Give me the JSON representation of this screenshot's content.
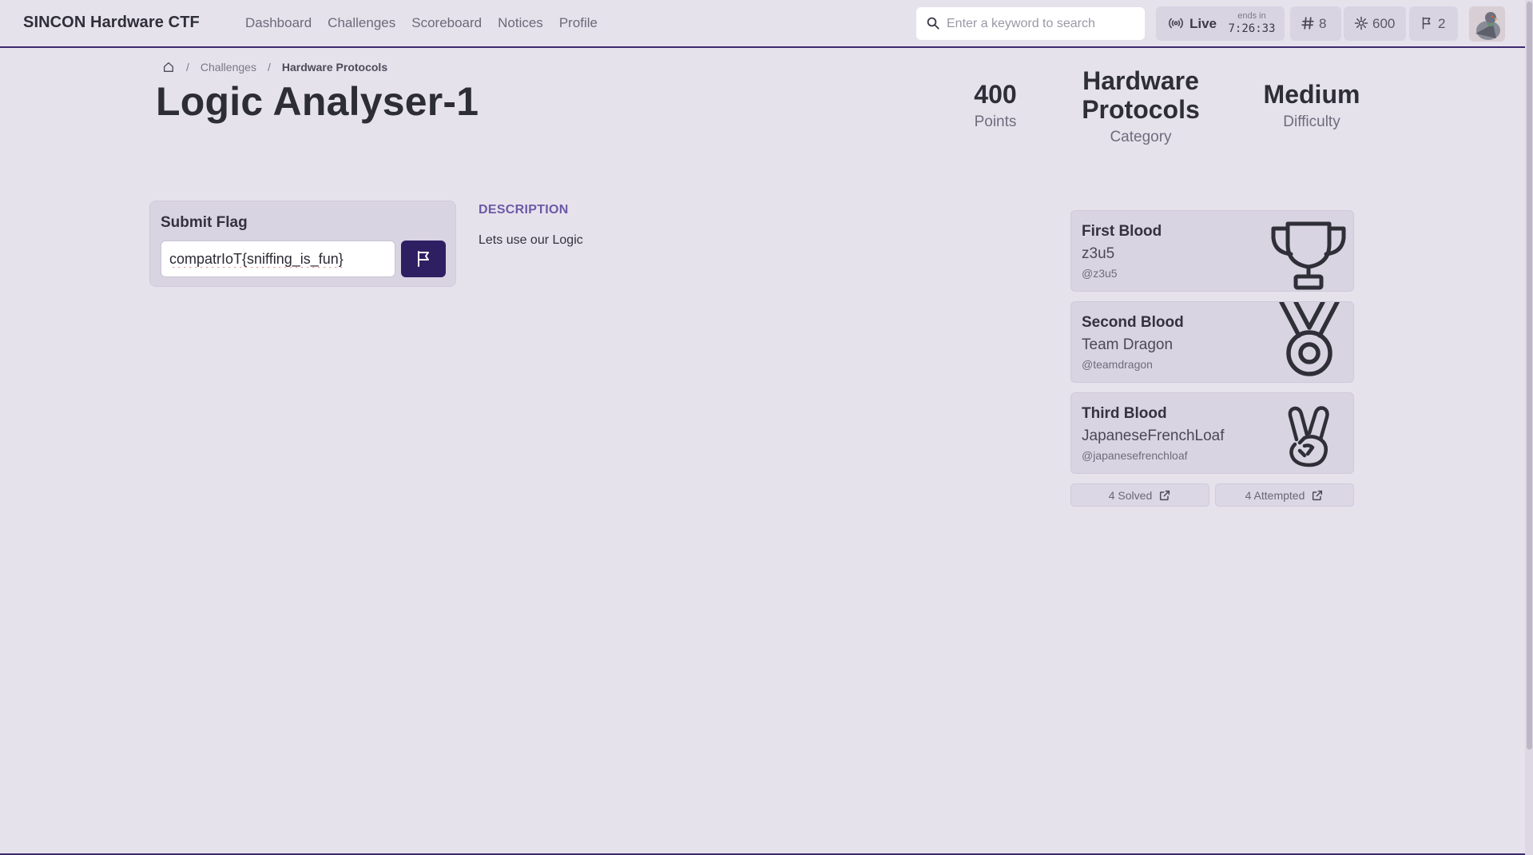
{
  "brand": "SINCON Hardware CTF",
  "nav": {
    "links": [
      "Dashboard",
      "Challenges",
      "Scoreboard",
      "Notices",
      "Profile"
    ]
  },
  "search": {
    "placeholder": "Enter a keyword to search",
    "value": ""
  },
  "status": {
    "live_label": "Live",
    "ends_label": "ends in",
    "timer": "7:26:33",
    "rank": "8",
    "points": "600",
    "flags": "2"
  },
  "breadcrumb": {
    "challenges": "Challenges",
    "current": "Hardware Protocols"
  },
  "challenge": {
    "title": "Logic Analyser-1",
    "points_value": "400",
    "points_label": "Points",
    "category_value": "Hardware Protocols",
    "category_label": "Category",
    "difficulty_value": "Medium",
    "difficulty_label": "Difficulty"
  },
  "flag": {
    "title": "Submit Flag",
    "value": "compatrIoT{sniffing_is_fun}"
  },
  "description": {
    "heading": "DESCRIPTION",
    "text": "Lets use our Logic"
  },
  "bloods": [
    {
      "title": "First Blood",
      "name": "z3u5",
      "handle": "@z3u5",
      "icon": "trophy-icon"
    },
    {
      "title": "Second Blood",
      "name": "Team Dragon",
      "handle": "@teamdragon",
      "icon": "medal-icon"
    },
    {
      "title": "Third Blood",
      "name": "JapaneseFrenchLoaf",
      "handle": "@japanesefrenchloaf",
      "icon": "victory-hand-icon"
    }
  ],
  "stats": {
    "solved": "4 Solved",
    "attempted": "4 Attempted"
  },
  "colors": {
    "accent": "#2e1f63",
    "background": "#e6e2ec",
    "card": "#d9d4e2",
    "description_heading": "#6a5aa6"
  }
}
